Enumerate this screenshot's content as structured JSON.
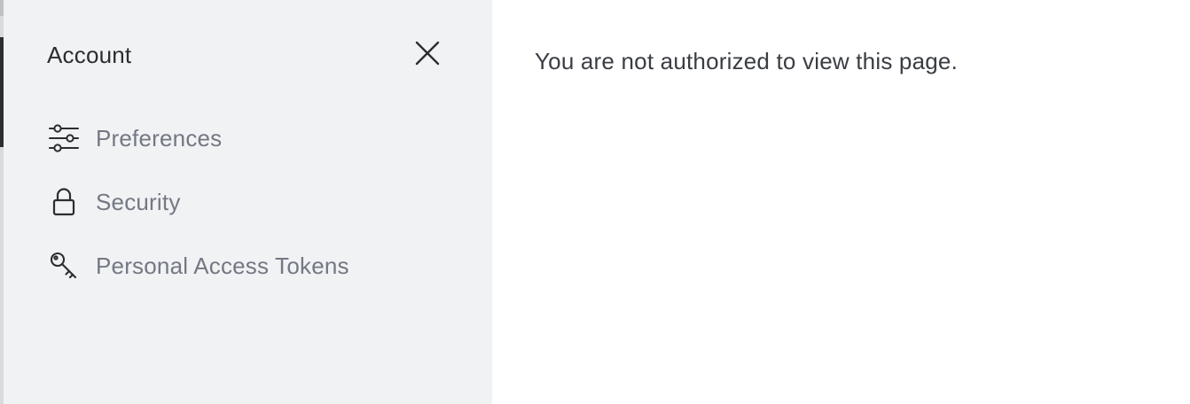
{
  "sidebar": {
    "title": "Account",
    "close_icon": "close-icon",
    "items": [
      {
        "label": "Preferences",
        "icon": "sliders-icon"
      },
      {
        "label": "Security",
        "icon": "lock-icon"
      },
      {
        "label": "Personal Access Tokens",
        "icon": "key-icon"
      }
    ]
  },
  "main": {
    "message": "You are not authorized to view this page."
  },
  "colors": {
    "sidebar_bg": "#f1f2f4",
    "title_text": "#2b2d31",
    "nav_text": "#737883",
    "message_text": "#3a3d42"
  }
}
